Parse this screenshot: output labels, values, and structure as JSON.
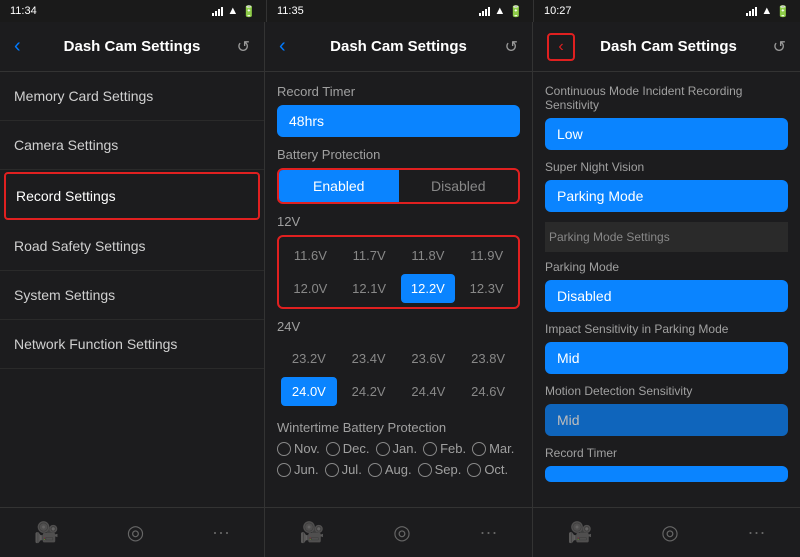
{
  "panels": [
    {
      "id": "panel1",
      "status_time": "11:34",
      "header_title": "Dash Cam Settings",
      "nav_items": [
        {
          "label": "Memory Card Settings",
          "active": false
        },
        {
          "label": "Camera Settings",
          "active": false
        },
        {
          "label": "Record Settings",
          "active": true
        },
        {
          "label": "Road Safety Settings",
          "active": false
        },
        {
          "label": "System Settings",
          "active": false
        },
        {
          "label": "Network Function Settings",
          "active": false
        }
      ],
      "tab_icons": [
        "📷",
        "◎",
        "···"
      ]
    },
    {
      "id": "panel2",
      "status_time": "11:35",
      "header_title": "Dash Cam Settings",
      "sections": {
        "record_timer_label": "Record Timer",
        "record_timer_value": "48hrs",
        "battery_protection_label": "Battery Protection",
        "battery_toggle": [
          "Enabled",
          "Disabled"
        ],
        "battery_toggle_active": 0,
        "voltage_12_label": "12V",
        "voltage_12_options": [
          "11.6V",
          "11.7V",
          "11.8V",
          "11.9V",
          "12.0V",
          "12.1V",
          "12.2V",
          "12.3V"
        ],
        "voltage_12_selected": 6,
        "voltage_24_label": "24V",
        "voltage_24_options": [
          "23.2V",
          "23.4V",
          "23.6V",
          "23.8V",
          "24.0V",
          "24.2V",
          "24.4V",
          "24.6V"
        ],
        "voltage_24_selected": 4,
        "wintertime_label": "Wintertime Battery Protection",
        "months_row1": [
          "Nov.",
          "Dec.",
          "Jan.",
          "Feb.",
          "Mar."
        ],
        "months_row2": [
          "Jun.",
          "Jul.",
          "Aug.",
          "Sep.",
          "Oct."
        ]
      }
    },
    {
      "id": "panel3",
      "status_time": "10:27",
      "header_title": "Dash Cam Settings",
      "settings": [
        {
          "label": "Continuous Mode Incident Recording Sensitivity",
          "value": "Low",
          "is_section_title": false
        },
        {
          "label": "Super Night Vision",
          "value": "Parking Mode",
          "is_section_title": false
        },
        {
          "label": "Parking Mode Settings",
          "value": null,
          "is_section_header": true
        },
        {
          "label": "Parking Mode",
          "value": "Disabled",
          "is_section_title": false
        },
        {
          "label": "Impact Sensitivity in Parking Mode",
          "value": "Mid",
          "is_section_title": false
        },
        {
          "label": "Motion Detection Sensitivity",
          "value": "Mid",
          "is_section_title": false
        },
        {
          "label": "Record Timer",
          "value": null,
          "is_section_title": false,
          "partial": true
        }
      ]
    }
  ]
}
